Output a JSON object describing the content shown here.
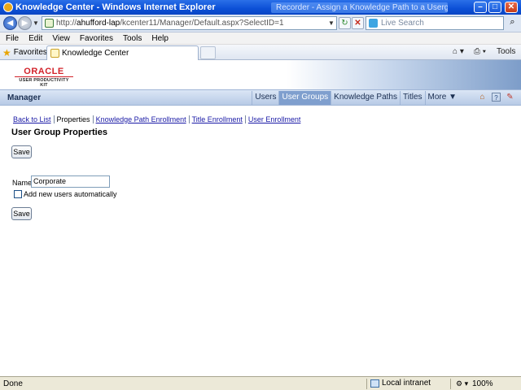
{
  "window": {
    "title": "Knowledge Center - Windows Internet Explorer",
    "background_task": "Recorder - Assign a Knowledge Path to a Usergroup",
    "controls": [
      "–",
      "□",
      "✕"
    ]
  },
  "address": {
    "url_prefix": "http://",
    "url_host": "ahufford-lap",
    "url_path": "/kcenter11/Manager/Default.aspx?SelectID=1",
    "search_placeholder": "Live Search"
  },
  "menu": [
    "File",
    "Edit",
    "View",
    "Favorites",
    "Tools",
    "Help"
  ],
  "favorites": {
    "label": "Favorites",
    "tab_title": "Knowledge Center",
    "tools_label": "Tools"
  },
  "brand": {
    "oracle": "ORACLE",
    "product": "USER PRODUCTIVITY KIT"
  },
  "nav": {
    "section": "Manager",
    "links": [
      "Users",
      "User Groups",
      "Knowledge Paths",
      "Titles",
      "More ▼"
    ],
    "active": "User Groups"
  },
  "subtabs": {
    "back": "Back to List",
    "properties": "Properties",
    "kp_enrollment": "Knowledge Path Enrollment",
    "title_enrollment": "Title Enrollment",
    "user_enrollment": "User Enrollment"
  },
  "page": {
    "title": "User Group Properties",
    "save_label": "Save",
    "name_label": "Name",
    "name_value": "Corporate",
    "auto_add_label": "Add new users automatically",
    "auto_add_checked": false
  },
  "status": {
    "text": "Done",
    "zone": "Local intranet",
    "zoom": "100%"
  }
}
